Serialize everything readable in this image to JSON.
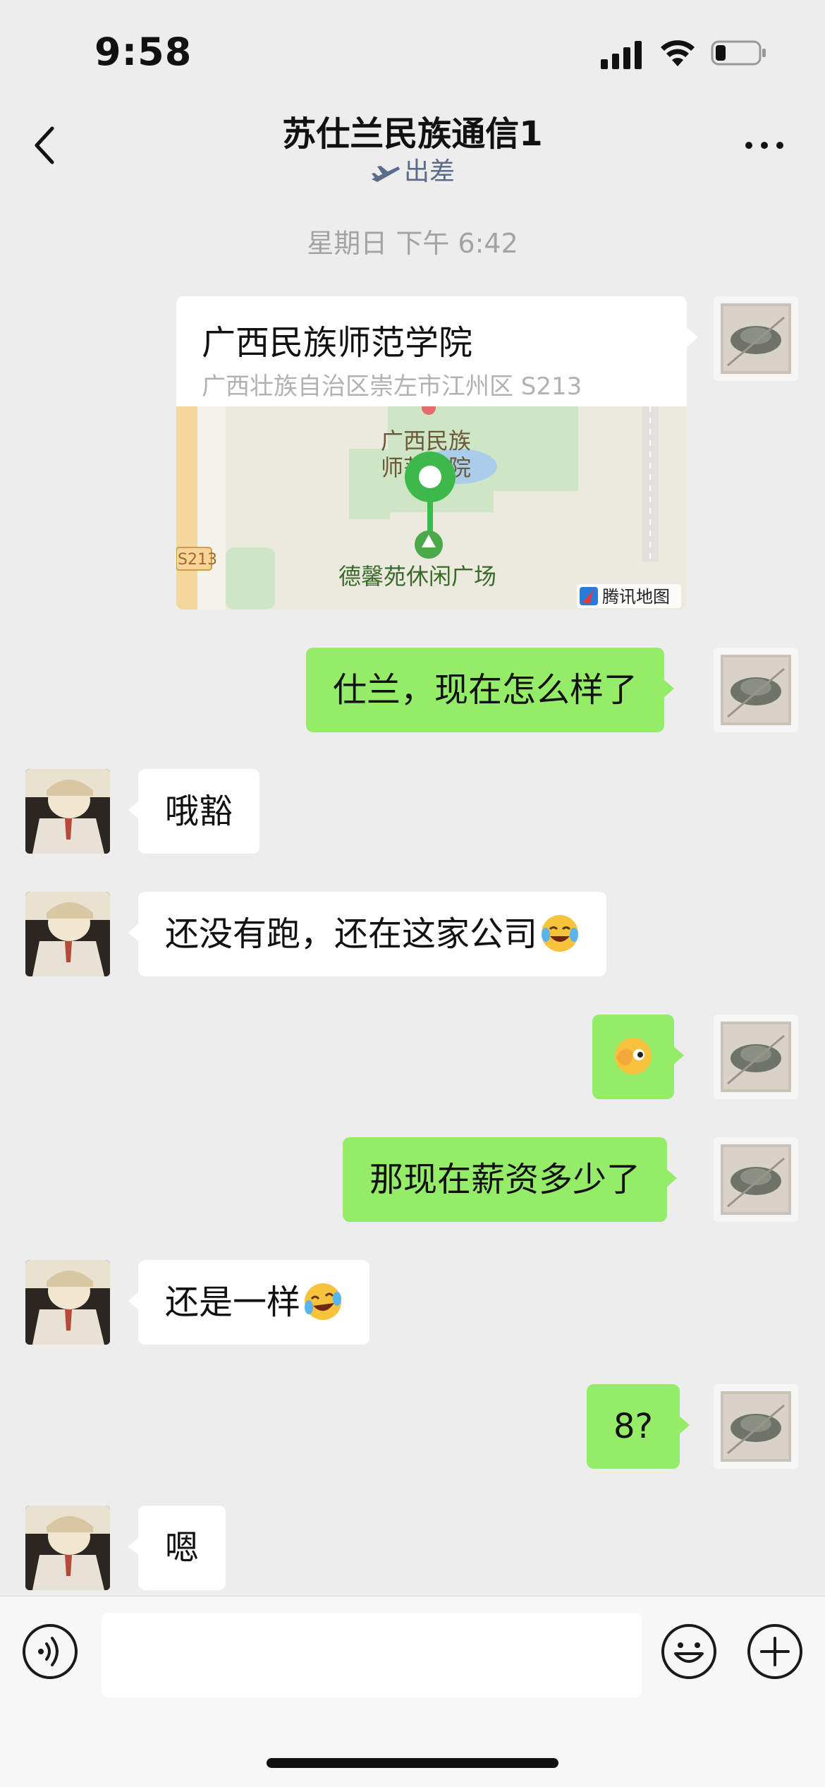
{
  "status_bar": {
    "time": "9:58"
  },
  "nav": {
    "title": "苏仕兰民族通信1",
    "status": "出差"
  },
  "timestamp": "星期日 下午 6:42",
  "location": {
    "title": "广西民族师范学院",
    "address": "广西壮族自治区崇左市江州区 S213",
    "map_label_1": "广西民族",
    "map_label_2": "师范学院",
    "map_label_3": "德馨苑休闲广场",
    "map_road": "S213",
    "map_brand": "腾讯地图"
  },
  "messages": [
    {
      "from": "me",
      "text": "仕兰，现在怎么样了"
    },
    {
      "from": "them",
      "text": "哦豁"
    },
    {
      "from": "them",
      "text": "还没有跑，还在这家公司",
      "emoji": "tears-of-joy"
    },
    {
      "from": "me",
      "text": "",
      "emoji": "face-palm-peek"
    },
    {
      "from": "me",
      "text": "那现在薪资多少了"
    },
    {
      "from": "them",
      "text": "还是一样",
      "emoji": "rolling-laughing"
    },
    {
      "from": "me",
      "text": "8?"
    },
    {
      "from": "them",
      "text": "嗯"
    }
  ],
  "colors": {
    "my_bubble": "#95ec69",
    "their_bubble": "#ffffff",
    "background": "#ededed"
  }
}
